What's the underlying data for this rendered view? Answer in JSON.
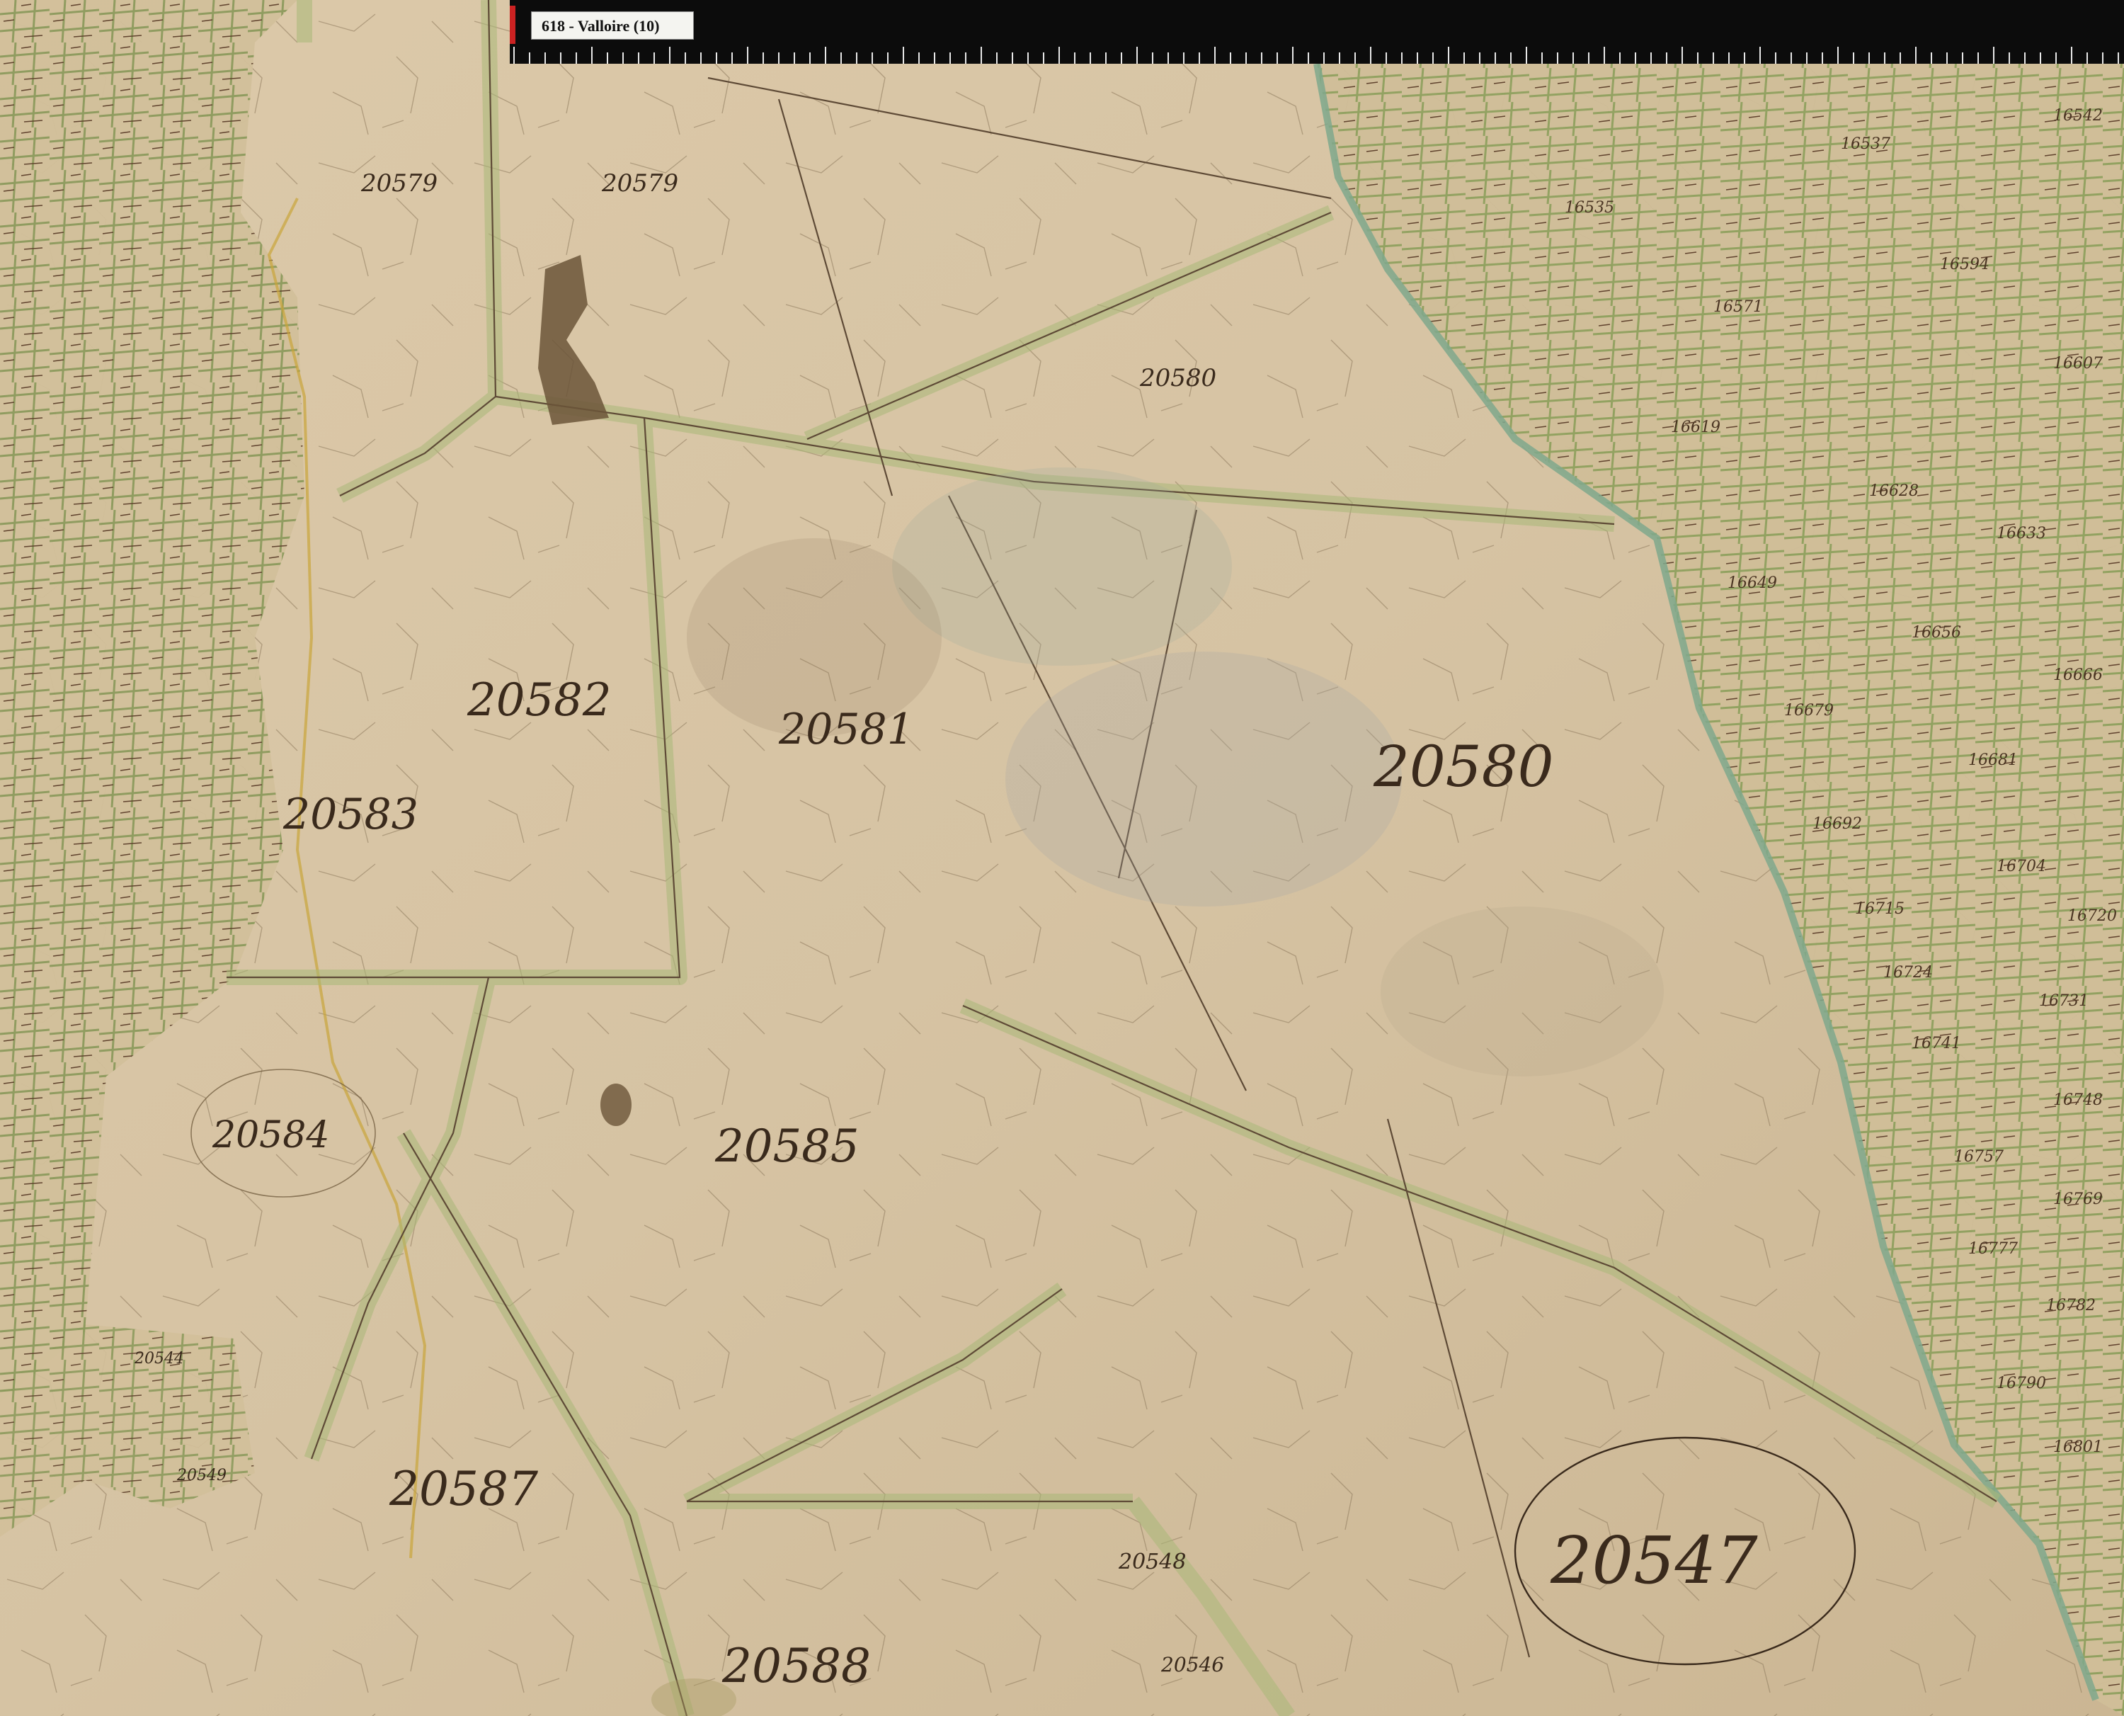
{
  "viewer": {
    "title": "618 - Valloire (10)"
  },
  "map": {
    "large_parcels": [
      {
        "id": "p-20579a",
        "label": "20579"
      },
      {
        "id": "p-20579b",
        "label": "20579"
      },
      {
        "id": "p-20580a",
        "label": "20580"
      },
      {
        "id": "p-20582",
        "label": "20582"
      },
      {
        "id": "p-20581",
        "label": "20581"
      },
      {
        "id": "p-20580b",
        "label": "20580"
      },
      {
        "id": "p-20583",
        "label": "20583"
      },
      {
        "id": "p-20584",
        "label": "20584"
      },
      {
        "id": "p-20585",
        "label": "20585"
      },
      {
        "id": "p-20587",
        "label": "20587"
      },
      {
        "id": "p-20588",
        "label": "20588"
      },
      {
        "id": "p-20547",
        "label": "20547"
      },
      {
        "id": "p-20548",
        "label": "20548"
      },
      {
        "id": "p-20546",
        "label": "20546"
      },
      {
        "id": "p-20544",
        "label": "20544"
      },
      {
        "id": "p-20549",
        "label": "20549"
      }
    ],
    "small_parcels": [
      "16535",
      "16537",
      "16542",
      "16571",
      "16594",
      "16607",
      "16619",
      "16628",
      "16633",
      "16649",
      "16656",
      "16666",
      "16679",
      "16681",
      "16692",
      "16704",
      "16715",
      "16720",
      "16724",
      "16731",
      "16741",
      "16748",
      "16757",
      "16769",
      "16777",
      "16782",
      "16790",
      "16801"
    ],
    "colors": {
      "paper": "#d8c6a8",
      "border_wash": "#a9b878",
      "ink": "#3a2a1c",
      "river": "#7fa88c",
      "stain": "#6b5538"
    }
  }
}
